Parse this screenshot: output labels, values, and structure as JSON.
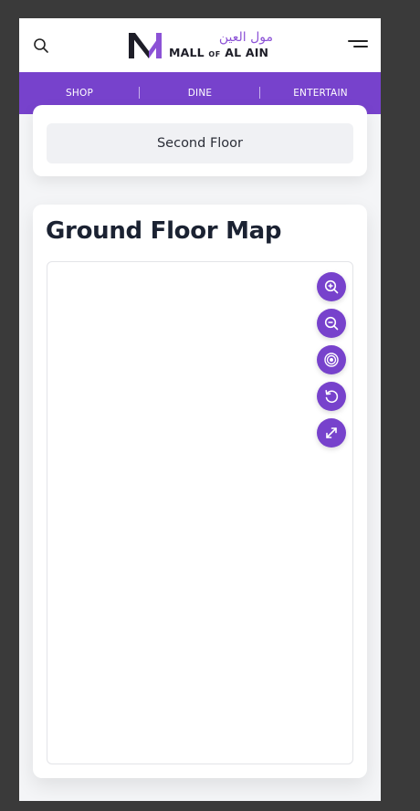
{
  "header": {
    "logo_arabic": "مول العين",
    "logo_latin_1": "MALL",
    "logo_latin_of": "OF",
    "logo_latin_2": "AL AIN",
    "icons": [
      "search-icon",
      "hamburger-menu-icon"
    ]
  },
  "nav": {
    "items": [
      {
        "label": "SHOP"
      },
      {
        "label": "DINE"
      },
      {
        "label": "ENTERTAIN"
      }
    ]
  },
  "floor_selector": {
    "selected_label": "Second Floor"
  },
  "map": {
    "title": "Ground Floor Map",
    "controls": [
      "zoom-in-icon",
      "zoom-out-icon",
      "locate-icon",
      "reset-icon",
      "fullscreen-icon"
    ]
  },
  "colors": {
    "brand_purple": "#7742cc",
    "logo_purple": "#8c52d6",
    "page_bg": "#3a3a3a",
    "content_bg": "#f4f5f7"
  }
}
